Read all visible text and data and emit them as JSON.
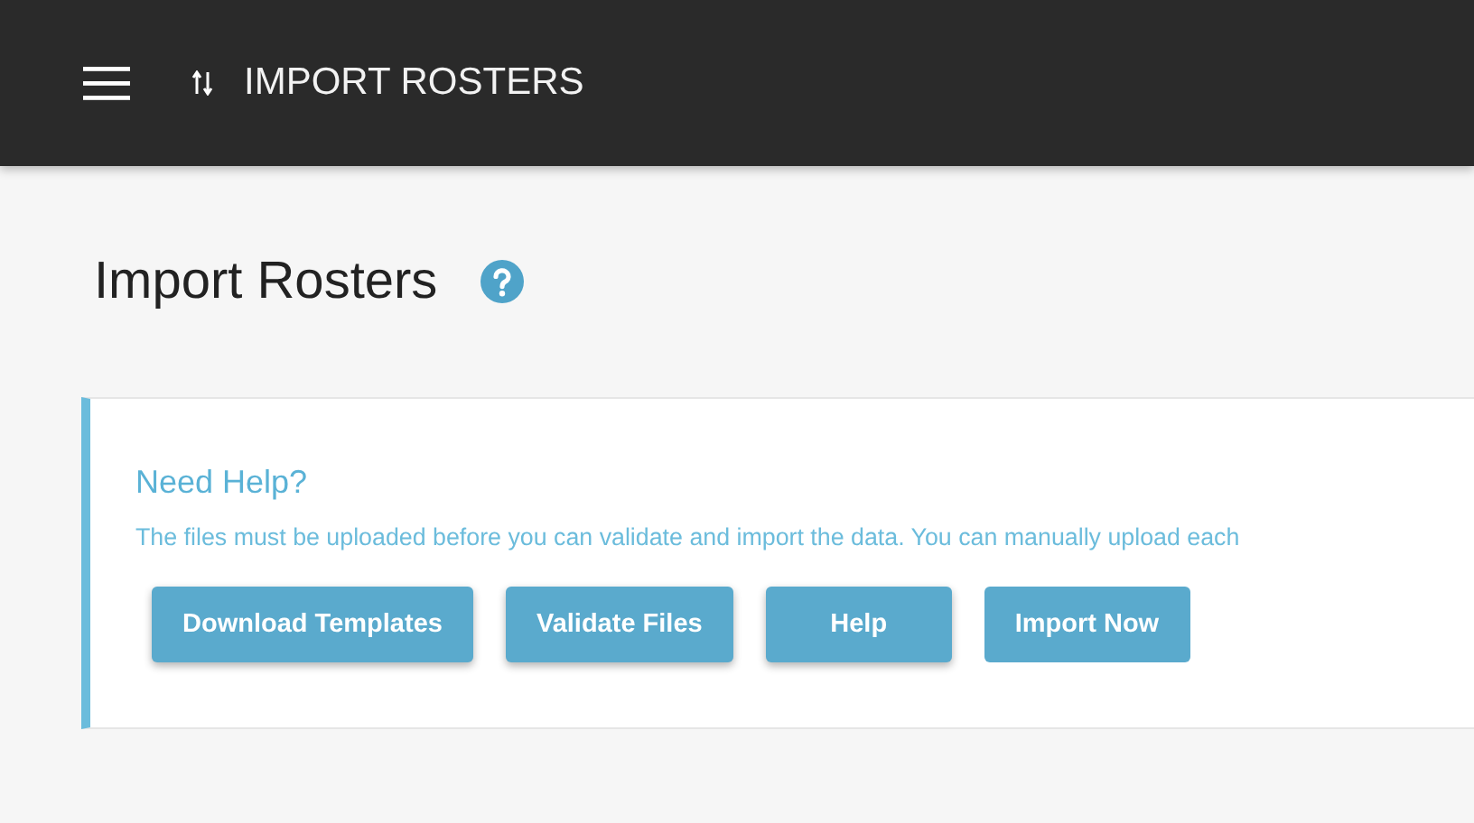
{
  "app_bar": {
    "title": "IMPORT ROSTERS"
  },
  "page": {
    "title": "Import Rosters"
  },
  "help_panel": {
    "heading": "Need Help?",
    "text": "The files must be uploaded before you can validate and import the data. You can manually upload each",
    "buttons": [
      {
        "label": "Download Templates",
        "raised": true
      },
      {
        "label": "Validate Files",
        "raised": true
      },
      {
        "label": "Help",
        "raised": true
      },
      {
        "label": "Import Now",
        "raised": false
      }
    ]
  }
}
